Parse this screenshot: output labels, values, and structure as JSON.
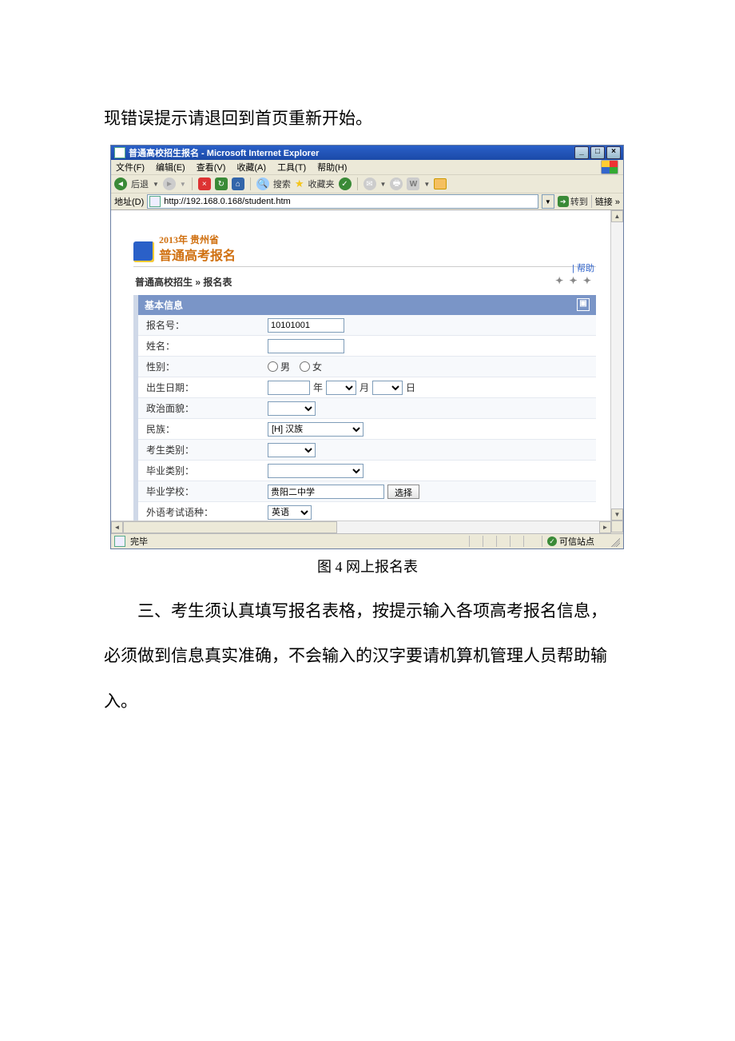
{
  "doc": {
    "line_top": "现错误提示请退回到首页重新开始。",
    "caption": "图 4 网上报名表",
    "para_1": "三、考生须认真填写报名表格，按提示输入各项高考报名信息，",
    "para_2": "必须做到信息真实准确，不会输入的汉字要请机算机管理人员帮助输",
    "para_3": "入。"
  },
  "window": {
    "title": "普通高校招生报名 - Microsoft Internet Explorer",
    "menus": [
      "文件(F)",
      "编辑(E)",
      "查看(V)",
      "收藏(A)",
      "工具(T)",
      "帮助(H)"
    ],
    "toolbar": {
      "back": "后退",
      "search": "搜索",
      "favorites": "收藏夹"
    },
    "address": {
      "label": "地址(D)",
      "url": "http://192.168.0.168/student.htm",
      "go": "转到",
      "links": "链接 »"
    },
    "status": {
      "done": "完毕",
      "trusted": "可信站点"
    }
  },
  "content": {
    "brand_year": "2013年 贵州省",
    "brand_title": "普通高考报名",
    "help": "| 帮助",
    "breadcrumb": "普通高校招生 » 报名表",
    "section": "基本信息",
    "rows": {
      "reg_no": {
        "label": "报名号：",
        "value": "10101001"
      },
      "name": {
        "label": "姓名：",
        "value": ""
      },
      "gender": {
        "label": "性别：",
        "male": "男",
        "female": "女"
      },
      "dob": {
        "label": "出生日期：",
        "y": "年",
        "m": "月",
        "d": "日"
      },
      "politics": {
        "label": "政治面貌："
      },
      "nation": {
        "label": "民族：",
        "value": "[H] 汉族"
      },
      "cand_type": {
        "label": "考生类别："
      },
      "grad_type": {
        "label": "毕业类别："
      },
      "grad_school": {
        "label": "毕业学校：",
        "value": "贵阳二中学",
        "btn": "选择"
      },
      "lang": {
        "label": "外语考试语种：",
        "value": "英语"
      }
    }
  }
}
